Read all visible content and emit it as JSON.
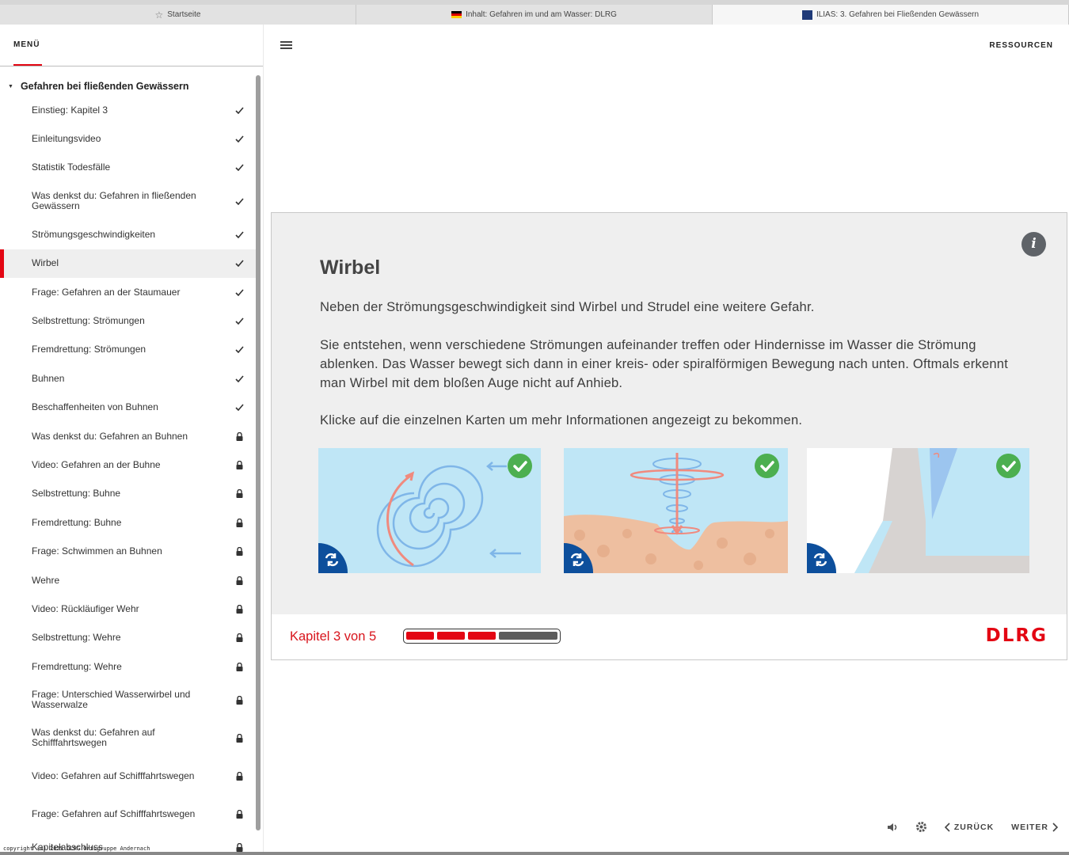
{
  "browser": {
    "tabs": [
      {
        "label": "Startseite",
        "icon": "star-icon"
      },
      {
        "label": "Inhalt: Gefahren im und am Wasser: DLRG",
        "icon": "flag-icon"
      },
      {
        "label": "ILIAS: 3. Gefahren bei Fließenden Gewässern",
        "icon": "ilias-icon",
        "active": true
      }
    ]
  },
  "sidebar": {
    "menu_label": "MENÜ",
    "section_title": "Gefahren bei fließenden Gewässern",
    "items": [
      {
        "label": "Einstieg: Kapitel 3",
        "state": "done"
      },
      {
        "label": "Einleitungsvideo",
        "state": "done"
      },
      {
        "label": "Statistik Todesfälle",
        "state": "done"
      },
      {
        "label": "Was denkst du: Gefahren in fließenden Gewässern",
        "state": "done"
      },
      {
        "label": "Strömungsgeschwindigkeiten",
        "state": "done"
      },
      {
        "label": "Wirbel",
        "state": "done",
        "active": true
      },
      {
        "label": "Frage: Gefahren an der Staumauer",
        "state": "done"
      },
      {
        "label": "Selbstrettung: Strömungen",
        "state": "done"
      },
      {
        "label": "Fremdrettung: Strömungen",
        "state": "done"
      },
      {
        "label": "Buhnen",
        "state": "done"
      },
      {
        "label": "Beschaffenheiten von Buhnen",
        "state": "done"
      },
      {
        "label": "Was denkst du: Gefahren an Buhnen",
        "state": "locked"
      },
      {
        "label": "Video: Gefahren an der Buhne",
        "state": "locked"
      },
      {
        "label": "Selbstrettung: Buhne",
        "state": "locked"
      },
      {
        "label": "Fremdrettung: Buhne",
        "state": "locked"
      },
      {
        "label": "Frage: Schwimmen an Buhnen",
        "state": "locked"
      },
      {
        "label": "Wehre",
        "state": "locked"
      },
      {
        "label": "Video: Rückläufiger Wehr",
        "state": "locked"
      },
      {
        "label": "Selbstrettung: Wehre",
        "state": "locked"
      },
      {
        "label": "Fremdrettung: Wehre",
        "state": "locked"
      },
      {
        "label": "Frage: Unterschied Wasserwirbel und Wasserwalze",
        "state": "locked"
      },
      {
        "label": "Was denkst du: Gefahren auf Schifffahrtswegen",
        "state": "locked"
      },
      {
        "label": "Video: Gefahren auf Schifffahrtswegen",
        "state": "locked"
      },
      {
        "label": "Frage: Gefahren auf Schifffahrtswegen",
        "state": "locked"
      },
      {
        "label": "Kapitelabschluss",
        "state": "locked"
      }
    ]
  },
  "header": {
    "resources_label": "RESSOURCEN"
  },
  "content": {
    "title": "Wirbel",
    "paragraphs": [
      "Neben der Strömungsgeschwindigkeit sind Wirbel und Strudel eine weitere Gefahr.",
      "Sie entstehen, wenn verschiedene Strömungen aufeinander treffen oder Hindernisse im Wasser die Strömung ablenken. Das Wasser bewegt sich dann in einer kreis- oder spiralförmigen Bewegung nach unten. Oftmals erkennt man Wirbel mit dem bloßen Auge nicht auf Anhieb.",
      "Klicke auf die einzelnen Karten um mehr Informationen angezeigt zu bekommen."
    ],
    "info_glyph": "i",
    "cards": [
      {
        "image": "spiral-whirl-illustration",
        "completed": true
      },
      {
        "image": "vortex-riverbed-illustration",
        "completed": true
      },
      {
        "image": "dam-wall-illustration",
        "completed": true
      }
    ]
  },
  "footer": {
    "chapter_label": "Kapitel 3 von 5",
    "progress": {
      "current": 3,
      "total": 5
    },
    "logo": "DLRG",
    "colors": {
      "accent": "#e30613",
      "done": "#e30613",
      "todo": "#5c5c5c"
    }
  },
  "nav": {
    "back_label": "ZURÜCK",
    "next_label": "WEITER"
  },
  "copyright": "copyright (c) 2025 DLRG Ortsgruppe Andernach"
}
